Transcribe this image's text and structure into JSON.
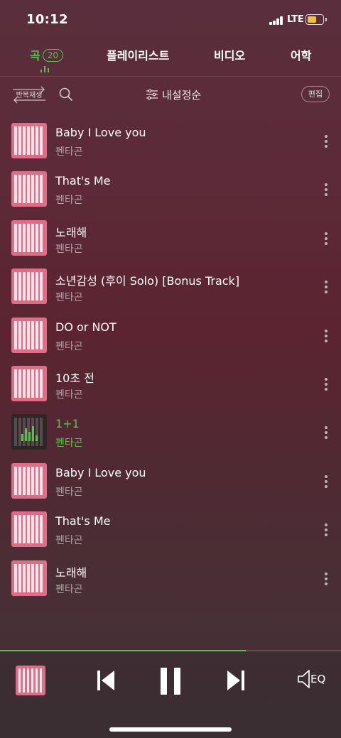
{
  "status_bar": {
    "time": "10:12",
    "network": "LTE",
    "battery_level": 0.6
  },
  "tabs": [
    {
      "label": "곡",
      "count": "20",
      "active": true
    },
    {
      "label": "플레이리스트"
    },
    {
      "label": "비디오"
    },
    {
      "label": "어학"
    }
  ],
  "toolbar": {
    "repeat_label": "반복재생",
    "sort_label": "내설정순",
    "edit_label": "편집"
  },
  "songs": [
    {
      "title": "Baby I Love you",
      "artist": "펜타곤"
    },
    {
      "title": "That's Me",
      "artist": "펜타곤"
    },
    {
      "title": "노래해",
      "artist": "펜타곤"
    },
    {
      "title": "소년감성 (후이 Solo) [Bonus Track]",
      "artist": "펜타곤"
    },
    {
      "title": "DO or NOT",
      "artist": "펜타곤"
    },
    {
      "title": "10초 전",
      "artist": "펜타곤"
    },
    {
      "title": "1+1",
      "artist": "펜타곤",
      "playing": true
    },
    {
      "title": "Baby I Love you",
      "artist": "펜타곤"
    },
    {
      "title": "That's Me",
      "artist": "펜타곤"
    },
    {
      "title": "노래해",
      "artist": "펜타곤"
    }
  ],
  "player": {
    "progress": 0.72,
    "eq_label": "EQ"
  },
  "colors": {
    "accent": "#5ac24a",
    "album": "#e06c88"
  }
}
